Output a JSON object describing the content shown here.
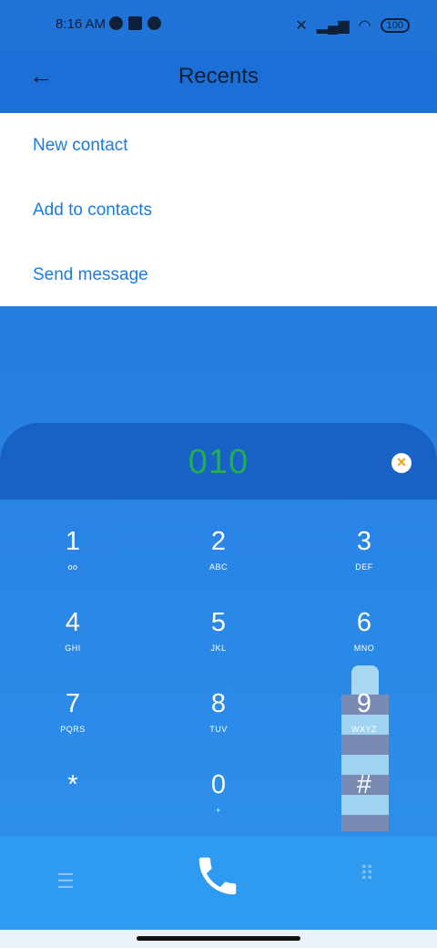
{
  "status_bar": {
    "time": "8:16 AM",
    "battery": "100"
  },
  "header": {
    "title": "Recents"
  },
  "menu": {
    "items": [
      {
        "label": "New contact"
      },
      {
        "label": "Add to contacts"
      },
      {
        "label": "Send message"
      }
    ]
  },
  "dialer": {
    "number": "010",
    "keys": [
      {
        "digit": "1",
        "letters": ""
      },
      {
        "digit": "2",
        "letters": "ABC"
      },
      {
        "digit": "3",
        "letters": "DEF"
      },
      {
        "digit": "4",
        "letters": "GHI"
      },
      {
        "digit": "5",
        "letters": "JKL"
      },
      {
        "digit": "6",
        "letters": "MNO"
      },
      {
        "digit": "7",
        "letters": "PQRS"
      },
      {
        "digit": "8",
        "letters": "TUV"
      },
      {
        "digit": "9",
        "letters": "WXYZ"
      },
      {
        "digit": "*",
        "letters": ""
      },
      {
        "digit": "0",
        "letters": "+"
      },
      {
        "digit": "#",
        "letters": ""
      }
    ]
  },
  "colors": {
    "number_color": "#22b04a",
    "menu_text": "#1a7be0",
    "header_bg": "#1c6fd6"
  }
}
